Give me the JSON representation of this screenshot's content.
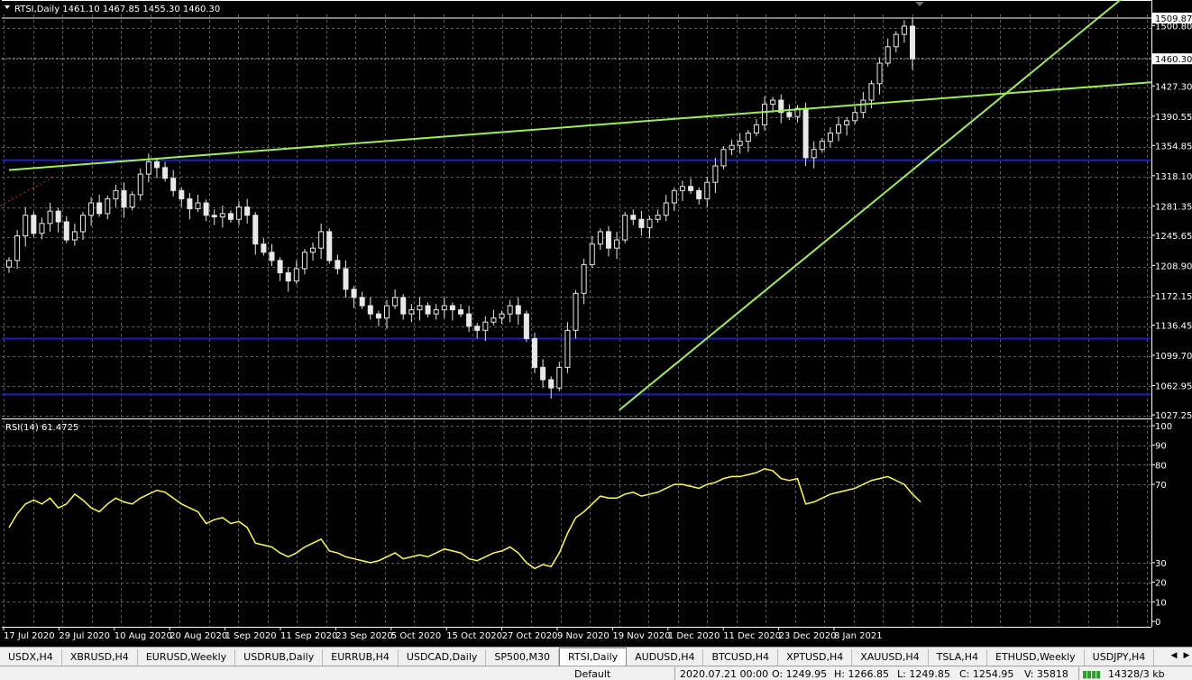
{
  "main_chart": {
    "header": "RTSI,Daily  1461.10 1467.85 1455.30 1460.30",
    "price_labels": [
      "1509.87",
      "1500.80",
      "1460.30",
      "1427.30",
      "1390.55",
      "1354.85",
      "1318.10",
      "1281.35",
      "1245.65",
      "1208.90",
      "1172.15",
      "1136.45",
      "1099.70",
      "1062.95",
      "1027.25"
    ],
    "highlighted_prices": [
      "1509.87",
      "1460.30"
    ]
  },
  "rsi": {
    "header": "RSI(14) 61.4725",
    "scale_labels": [
      "100",
      "90",
      "80",
      "70",
      "30",
      "20",
      "10",
      "0"
    ]
  },
  "x_axis_labels": [
    "17 Jul 2020",
    "29 Jul 2020",
    "10 Aug 2020",
    "20 Aug 2020",
    "1 Sep 2020",
    "11 Sep 2020",
    "23 Sep 2020",
    "5 Oct 2020",
    "15 Oct 2020",
    "27 Oct 2020",
    "9 Nov 2020",
    "19 Nov 2020",
    "1 Dec 2020",
    "11 Dec 2020",
    "23 Dec 2020",
    "8 Jan 2021"
  ],
  "tabs": [
    {
      "label": "USDX,H4"
    },
    {
      "label": "XBRUSD,H4"
    },
    {
      "label": "EURUSD,Weekly"
    },
    {
      "label": "USDRUB,Daily"
    },
    {
      "label": "EURRUB,H4"
    },
    {
      "label": "USDCAD,Daily"
    },
    {
      "label": "SP500,M30"
    },
    {
      "label": "RTSI,Daily",
      "active": true
    },
    {
      "label": "AUDUSD,H4"
    },
    {
      "label": "BTCUSD,H4"
    },
    {
      "label": "XPTUSD,H4"
    },
    {
      "label": "XAUUSD,H4"
    },
    {
      "label": "TSLA,H4"
    },
    {
      "label": "ETHUSD,Weekly"
    },
    {
      "label": "USDJPY,H4"
    }
  ],
  "status": {
    "profile": "Default",
    "datetime": "2020.07.21 00:00",
    "open": "O: 1249.95",
    "high": "H: 1266.85",
    "low": "L: 1249.85",
    "close": "C: 1254.95",
    "volume": "V: 35818",
    "traffic": "14328/3 kb"
  },
  "colors": {
    "background": "#000000",
    "grid": "#5f5f5f",
    "candle": "#e8e8e8",
    "trendline": "#9ef04e",
    "horizontal_level": "#1c1cc8",
    "rsi_line": "#ffff40"
  },
  "chart_data": [
    {
      "type": "candlestick",
      "title": "RTSI,Daily",
      "ohlc_last": {
        "open": 1461.1,
        "high": 1467.85,
        "low": 1455.3,
        "close": 1460.3
      },
      "ylim": [
        1027.25,
        1509.87
      ],
      "x_start": "2020-07-17",
      "closes": [
        1215,
        1245,
        1270,
        1248,
        1260,
        1275,
        1262,
        1240,
        1250,
        1270,
        1285,
        1272,
        1290,
        1300,
        1280,
        1295,
        1320,
        1335,
        1328,
        1315,
        1300,
        1290,
        1278,
        1285,
        1270,
        1268,
        1272,
        1265,
        1280,
        1270,
        1235,
        1225,
        1215,
        1200,
        1190,
        1205,
        1225,
        1230,
        1250,
        1215,
        1205,
        1180,
        1170,
        1160,
        1150,
        1145,
        1160,
        1170,
        1150,
        1155,
        1160,
        1150,
        1155,
        1160,
        1155,
        1150,
        1135,
        1130,
        1140,
        1145,
        1150,
        1160,
        1150,
        1120,
        1085,
        1070,
        1060,
        1085,
        1130,
        1175,
        1210,
        1235,
        1250,
        1230,
        1240,
        1270,
        1265,
        1255,
        1265,
        1270,
        1285,
        1300,
        1305,
        1300,
        1290,
        1310,
        1330,
        1350,
        1355,
        1360,
        1370,
        1380,
        1405,
        1410,
        1395,
        1390,
        1400,
        1340,
        1350,
        1360,
        1370,
        1380,
        1385,
        1395,
        1410,
        1430,
        1455,
        1475,
        1490,
        1500,
        1460
      ],
      "levels": [
        1337,
        1120,
        1052
      ],
      "trendlines": [
        {
          "from": [
            "2020-07-17",
            1325
          ],
          "to": [
            "2021-01-19",
            1427
          ]
        },
        {
          "from": [
            "2020-10-29",
            1033
          ],
          "to": [
            "2021-01-19",
            1512
          ]
        }
      ]
    },
    {
      "type": "line",
      "title": "RSI(14) 61.4725",
      "ylim": [
        0,
        100
      ],
      "series": [
        {
          "name": "RSI(14)",
          "values": [
            48,
            55,
            60,
            62,
            60,
            63,
            58,
            60,
            65,
            62,
            58,
            56,
            60,
            63,
            61,
            60,
            63,
            65,
            67,
            66,
            63,
            60,
            58,
            56,
            50,
            52,
            53,
            50,
            51,
            48,
            40,
            39,
            38,
            35,
            33,
            35,
            38,
            40,
            42,
            36,
            35,
            33,
            32,
            31,
            30,
            31,
            33,
            35,
            32,
            33,
            34,
            33,
            35,
            37,
            36,
            35,
            32,
            31,
            33,
            35,
            36,
            38,
            35,
            30,
            27,
            29,
            28,
            35,
            45,
            53,
            56,
            60,
            64,
            63,
            63,
            65,
            66,
            64,
            65,
            66,
            68,
            70,
            70,
            69,
            68,
            70,
            71,
            73,
            74,
            74,
            75,
            76,
            78,
            77,
            73,
            72,
            73,
            60,
            61,
            63,
            65,
            66,
            67,
            68,
            70,
            72,
            73,
            74,
            72,
            70,
            65,
            61
          ]
        }
      ]
    }
  ]
}
